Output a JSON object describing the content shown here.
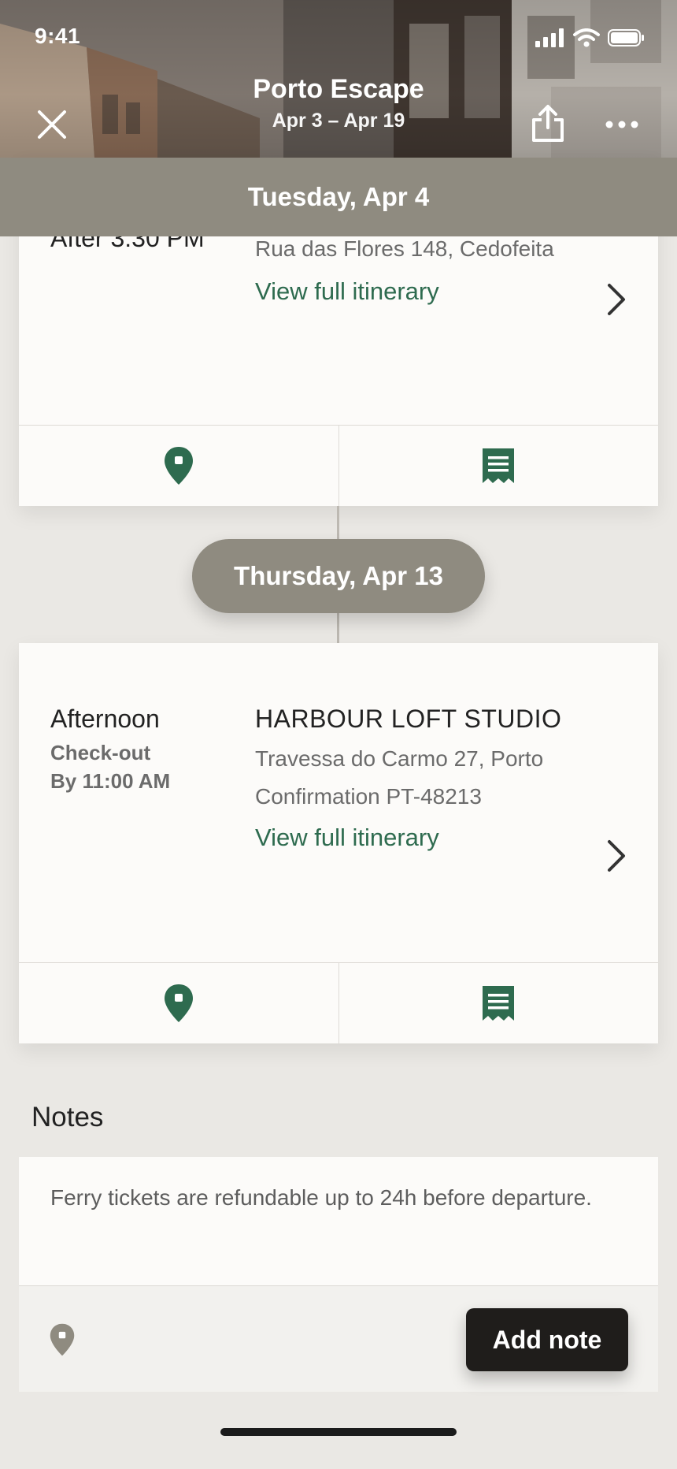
{
  "status_bar": {
    "time": "9:41"
  },
  "header": {
    "title": "Porto Escape",
    "dates": "Apr 3 – Apr 19"
  },
  "sticky_day": "Tuesday, Apr 4",
  "card1": {
    "time_partial": "After 3:30 PM",
    "address": "Rua das Flores 148, Cedofeita",
    "link": "View full itinerary"
  },
  "day_pill": "Thursday, Apr 13",
  "card2": {
    "time_main": "Afternoon",
    "time_sub1": "Check-out",
    "time_sub2": "By 11:00 AM",
    "title": "HARBOUR LOFT STUDIO",
    "address": "Travessa do Carmo 27, Porto",
    "confirmation": "Confirmation PT-48213",
    "link": "View full itinerary"
  },
  "notes": {
    "heading": "Notes",
    "text": "Ferry tickets are refundable up to 24h before departure.",
    "button": "Add note"
  },
  "colors": {
    "accent_green": "#2e6b4f",
    "day_bar": "#8f8b80",
    "button_dark": "#1f1d1b"
  },
  "icons": [
    "close-icon",
    "share-icon",
    "more-icon",
    "map-pin-icon",
    "receipt-icon",
    "chevron-right-icon"
  ]
}
